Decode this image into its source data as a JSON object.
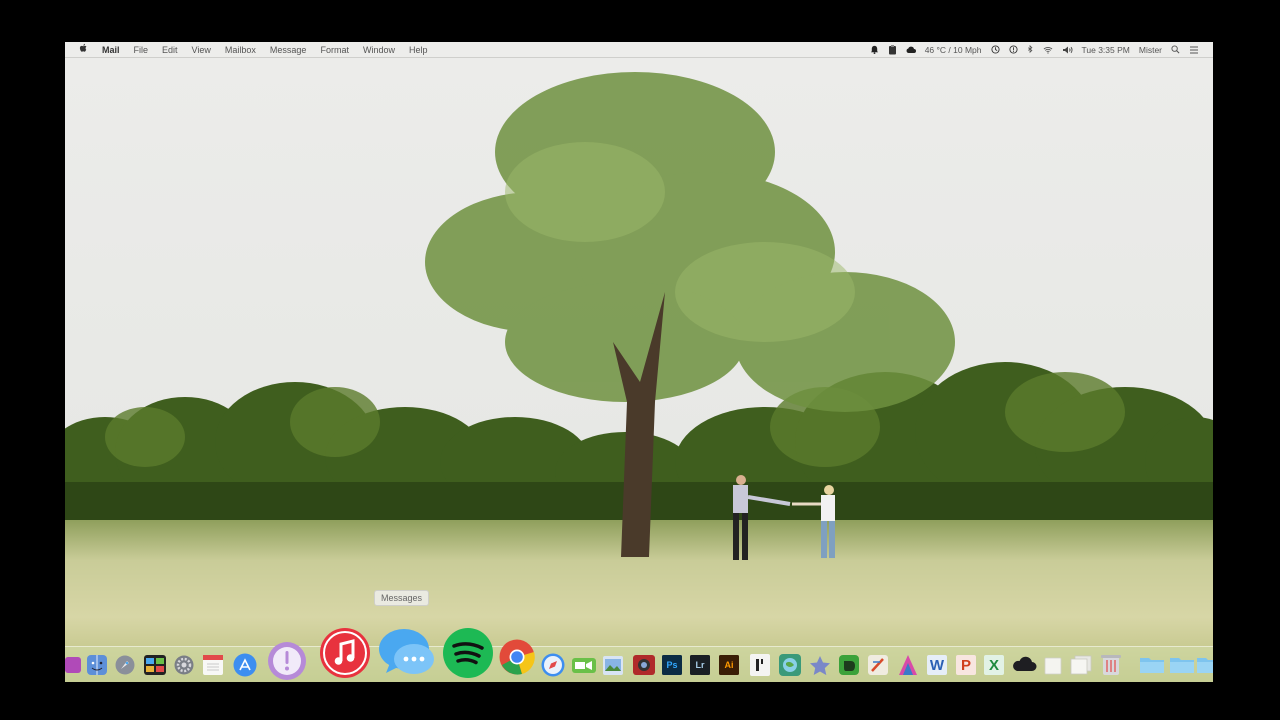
{
  "menubar": {
    "apple_icon": "apple-logo",
    "app_name": "Mail",
    "menus": [
      "File",
      "Edit",
      "View",
      "Mailbox",
      "Message",
      "Format",
      "Window",
      "Help"
    ],
    "status": {
      "weather": "46 °C / 10 Mph",
      "clock": "Tue 3:35 PM",
      "user": "Mister"
    }
  },
  "tooltip": {
    "text": "Messages"
  },
  "dock": {
    "apps": [
      {
        "name": "Messages",
        "color": "#4aa8f0"
      },
      {
        "name": "iTunes",
        "color": "#e8323e"
      },
      {
        "name": "Spotify",
        "color": "#1db954"
      },
      {
        "name": "Chrome",
        "color": "#4285f4"
      }
    ],
    "labels": {
      "photoshop": "Ps",
      "lightroom": "Lr",
      "illustrator": "Ai",
      "word": "W",
      "powerpoint": "P",
      "excel": "X"
    }
  },
  "colors": {
    "sky": "#e9e9e7",
    "trees": "#3a5a1c",
    "grass": "#c8cc90",
    "dock_tint": "#d2dcaa"
  }
}
